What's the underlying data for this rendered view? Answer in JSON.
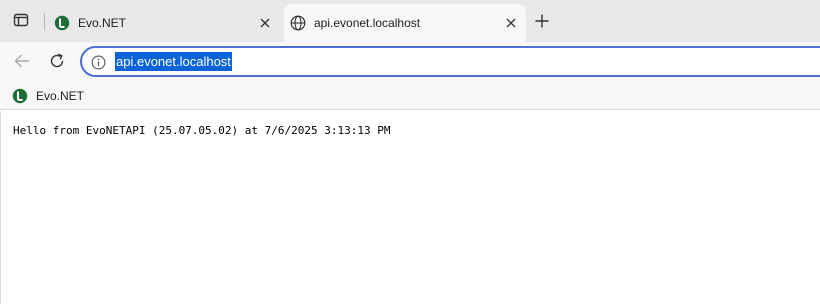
{
  "browser": {
    "tabs": [
      {
        "title": "Evo.NET",
        "icon": "evonet-logo-icon",
        "active": false
      },
      {
        "title": "api.evonet.localhost",
        "icon": "globe-icon",
        "active": true
      }
    ],
    "address_bar": {
      "url": "api.evonet.localhost"
    },
    "bookmarks": [
      {
        "label": "Evo.NET",
        "icon": "evonet-logo-icon"
      }
    ]
  },
  "page": {
    "body_text": "Hello from EvoNETAPI (25.07.05.02) at 7/6/2025 3:13:13 PM"
  },
  "colors": {
    "tabstrip": "#e8e8e8",
    "toolbar": "#f7f7f7",
    "omnibox_border": "#4d6fd6",
    "selection": "#0a64d8",
    "evonet_logo": "#1e6e3a"
  }
}
